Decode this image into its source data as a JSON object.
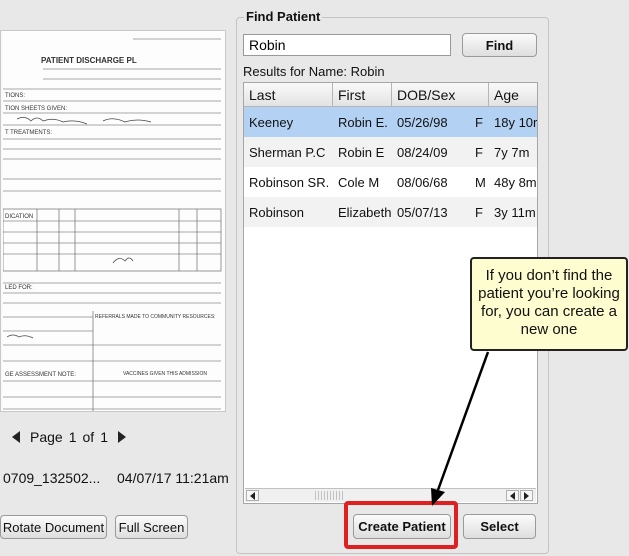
{
  "document": {
    "header_title": "PATIENT DISCHARGE PL",
    "form_lines": [
      "TIONS:",
      "TION SHEETS GIVEN:",
      "T TREATMENTS:",
      "DICATION",
      "LED FOR:",
      "GE ASSESSMENT NOTE:",
      "REFERRALS MADE TO COMMUNITY RESOURCES:",
      "VACCINES GIVEN THIS ADMISSION"
    ]
  },
  "pager": {
    "page_label": "Page",
    "current": "1",
    "of_label": "of",
    "total": "1"
  },
  "file": {
    "name": "0709_132502...",
    "date": "04/07/17 11:21am"
  },
  "buttons": {
    "rotate": "Rotate Document",
    "full_screen": "Full Screen",
    "find": "Find",
    "create_patient": "Create Patient",
    "select": "Select"
  },
  "find_panel": {
    "legend": "Find Patient",
    "search_value": "Robin",
    "results_label": "Results for Name: Robin"
  },
  "table": {
    "columns": [
      "Last",
      "First",
      "DOB/Sex",
      "Age"
    ],
    "rows": [
      {
        "last": "Keeney",
        "first": "Robin E.",
        "dob": "05/26/98",
        "sex": "F",
        "age": "18y 10r"
      },
      {
        "last": "Sherman P.C",
        "first": "Robin E",
        "dob": "08/24/09",
        "sex": "F",
        "age": "7y 7m"
      },
      {
        "last": "Robinson SR.",
        "first": "Cole M",
        "dob": "08/06/68",
        "sex": "M",
        "age": "48y 8m"
      },
      {
        "last": "Robinson",
        "first": "Elizabeth",
        "dob": "05/07/13",
        "sex": "F",
        "age": "3y 11m"
      }
    ]
  },
  "callout": {
    "text": "If you don’t find the patient you’re looking for, you can create a new one"
  }
}
